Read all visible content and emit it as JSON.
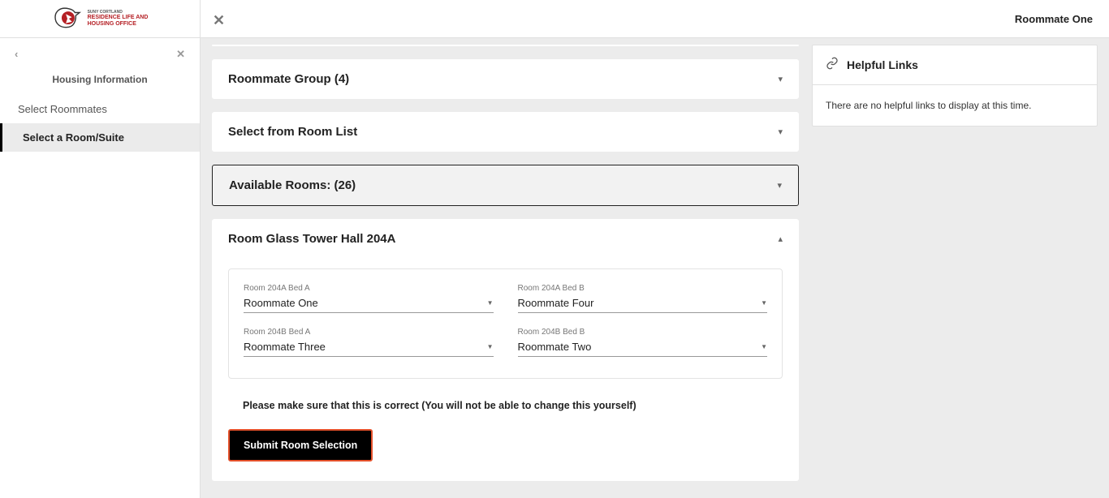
{
  "header": {
    "logo_line1": "SUNY CORTLAND",
    "logo_line2": "RESIDENCE LIFE AND",
    "logo_line3": "HOUSING OFFICE",
    "user_name": "Roommate One"
  },
  "sidebar": {
    "heading": "Housing Information",
    "items": [
      {
        "label": "Select Roommates",
        "active": false
      },
      {
        "label": "Select a Room/Suite",
        "active": true
      }
    ]
  },
  "main": {
    "panels": {
      "roommate_group": "Roommate Group (4)",
      "room_list": "Select from Room List",
      "available_rooms": "Available Rooms: (26)",
      "room_detail": "Room Glass Tower Hall 204A"
    },
    "beds": [
      {
        "label": "Room 204A Bed A",
        "value": "Roommate One"
      },
      {
        "label": "Room 204A Bed B",
        "value": "Roommate Four"
      },
      {
        "label": "Room 204B Bed A",
        "value": "Roommate Three"
      },
      {
        "label": "Room 204B Bed B",
        "value": "Roommate Two"
      }
    ],
    "warning": "Please make sure that this is correct (You will not be able to change this yourself)",
    "submit_label": "Submit Room Selection"
  },
  "helpful": {
    "title": "Helpful Links",
    "body": "There are no helpful links to display at this time."
  }
}
